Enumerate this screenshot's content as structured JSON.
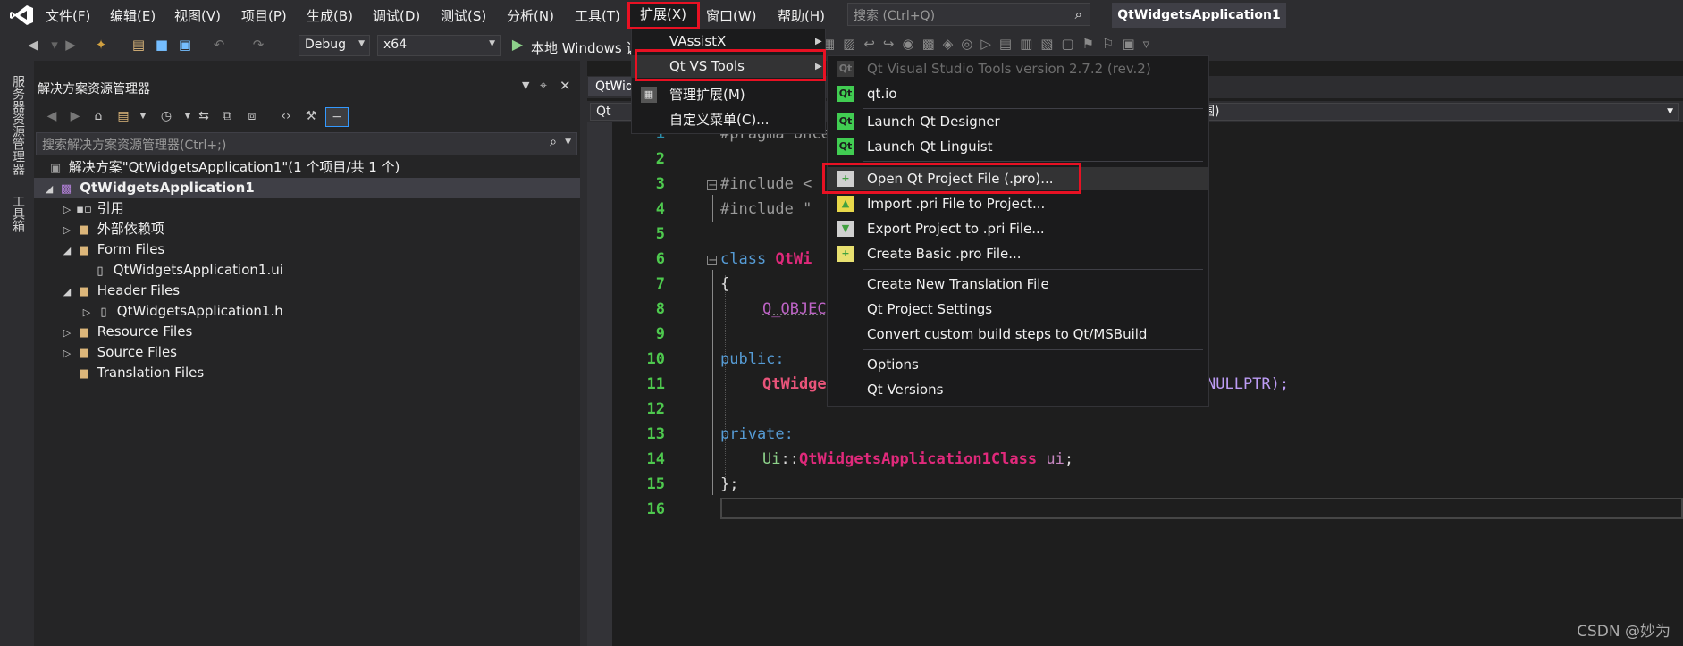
{
  "menubar": {
    "items": [
      "文件(F)",
      "编辑(E)",
      "视图(V)",
      "项目(P)",
      "生成(B)",
      "调试(D)",
      "测试(S)",
      "分析(N)",
      "工具(T)",
      "扩展(X)",
      "窗口(W)",
      "帮助(H)"
    ],
    "search_placeholder": "搜索 (Ctrl+Q)",
    "window_title": "QtWidgetsApplication1"
  },
  "toolbar": {
    "config": "Debug",
    "platform": "x64",
    "run_label": "本地 Windows 调"
  },
  "left_strip": {
    "server_explorer": "服务器资源管理器",
    "toolbox": "工具箱"
  },
  "solution_explorer": {
    "title": "解决方案资源管理器",
    "search_placeholder": "搜索解决方案资源管理器(Ctrl+;)",
    "tree": [
      "解决方案\"QtWidgetsApplication1\"(1 个项目/共 1 个)",
      "QtWidgetsApplication1",
      "引用",
      "外部依赖项",
      "Form Files",
      "QtWidgetsApplication1.ui",
      "Header Files",
      "QtWidgetsApplication1.h",
      "Resource Files",
      "Source Files",
      "Translation Files"
    ]
  },
  "editor": {
    "tab": "QtWidg",
    "nav_left": "Qt",
    "nav_right": "围)",
    "line_numbers": [
      "1",
      "2",
      "3",
      "4",
      "5",
      "6",
      "7",
      "8",
      "9",
      "10",
      "11",
      "12",
      "13",
      "14",
      "15",
      "16"
    ],
    "code": {
      "l1": "#pragma once",
      "l3": "#include <",
      "l4": "#include \"",
      "l6_kw": "class",
      "l6_cls": "QtWi",
      "l7": "{",
      "l8": "Q_OBJEC",
      "l10": "public:",
      "l11_a": "QtWidge",
      "l11_b": "NULLPTR);",
      "l13": "private:",
      "l14_ns": "Ui",
      "l14_sep": "::",
      "l14_cls": "QtWidgetsApplication1Class",
      "l14_mem": "ui",
      "l14_end": ";",
      "l15": "};"
    }
  },
  "extensions_menu": {
    "items": [
      "VAssistX",
      "Qt VS Tools",
      "管理扩展(M)",
      "自定义菜单(C)..."
    ]
  },
  "qt_menu": {
    "version": "Qt Visual Studio Tools version 2.7.2 (rev.2)",
    "items": [
      "qt.io",
      "Launch Qt Designer",
      "Launch Qt Linguist",
      "Open Qt Project File (.pro)...",
      "Import .pri File to Project...",
      "Export Project to .pri File...",
      "Create Basic .pro File...",
      "Create New Translation File",
      "Qt Project Settings",
      "Convert custom build steps to Qt/MSBuild",
      "Options",
      "Qt Versions"
    ]
  },
  "watermark": "CSDN @妙为",
  "colors": {
    "highlight_box": "#e81123",
    "qt_green": "#41cd52",
    "vs_purple": "#68217a"
  }
}
